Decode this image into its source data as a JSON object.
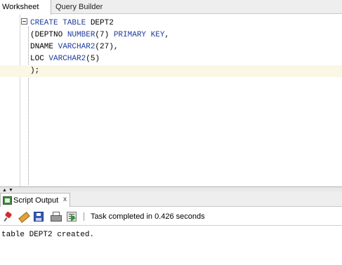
{
  "tabs": {
    "worksheet": "Worksheet",
    "query_builder": "Query Builder"
  },
  "editor": {
    "lines": [
      [
        {
          "t": "CREATE TABLE",
          "kw": true
        },
        {
          "t": " DEPT2",
          "kw": false
        }
      ],
      [
        {
          "t": "(DEPTNO ",
          "kw": false
        },
        {
          "t": "NUMBER",
          "kw": true
        },
        {
          "t": "(7) ",
          "kw": false
        },
        {
          "t": "PRIMARY KEY",
          "kw": true
        },
        {
          "t": ",",
          "kw": false
        }
      ],
      [
        {
          "t": "DNAME ",
          "kw": false
        },
        {
          "t": "VARCHAR2",
          "kw": true
        },
        {
          "t": "(27),",
          "kw": false
        }
      ],
      [
        {
          "t": "LOC ",
          "kw": false
        },
        {
          "t": "VARCHAR2",
          "kw": true
        },
        {
          "t": "(5)",
          "kw": false
        }
      ],
      [
        {
          "t": ");",
          "kw": false
        }
      ]
    ],
    "keyword_color": "#1f3d9e",
    "current_line_color": "#fbf7e5"
  },
  "output": {
    "tab_label": "Script Output",
    "close_glyph": "x",
    "status": "Task completed in 0.426 seconds",
    "result_text": "table DEPT2 created.",
    "toolbar_icons": [
      "pin-icon",
      "clear-icon",
      "save-icon",
      "print-icon",
      "run-script-icon"
    ]
  },
  "splitter": {
    "collapse_up": "▲",
    "expand_down": "▼"
  }
}
